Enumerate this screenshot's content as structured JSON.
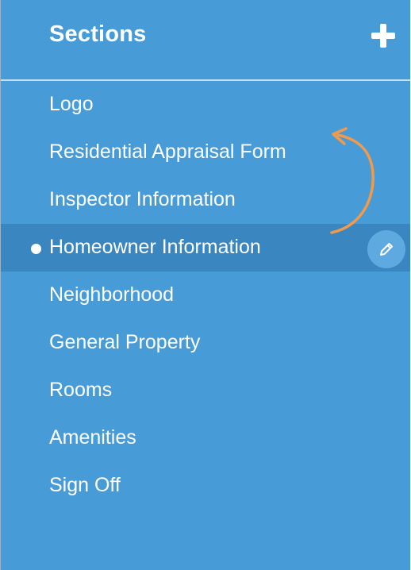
{
  "sidebar": {
    "title": "Sections",
    "items": [
      {
        "label": "Logo"
      },
      {
        "label": "Residential Appraisal Form"
      },
      {
        "label": "Inspector Information"
      },
      {
        "label": "Homeowner Information",
        "active": true
      },
      {
        "label": "Neighborhood"
      },
      {
        "label": "General Property"
      },
      {
        "label": "Rooms"
      },
      {
        "label": "Amenities"
      },
      {
        "label": "Sign Off"
      }
    ]
  },
  "icons": {
    "add": "plus-icon",
    "edit": "pencil-icon",
    "active_marker": "bullet-dot",
    "annotation": "curved-arrow"
  },
  "colors": {
    "panel_background": "#479bd7",
    "active_row": "#3a86c1",
    "edit_button": "#5ea9e0",
    "annotation_arrow": "#f39a4a",
    "text": "#ffffff"
  }
}
